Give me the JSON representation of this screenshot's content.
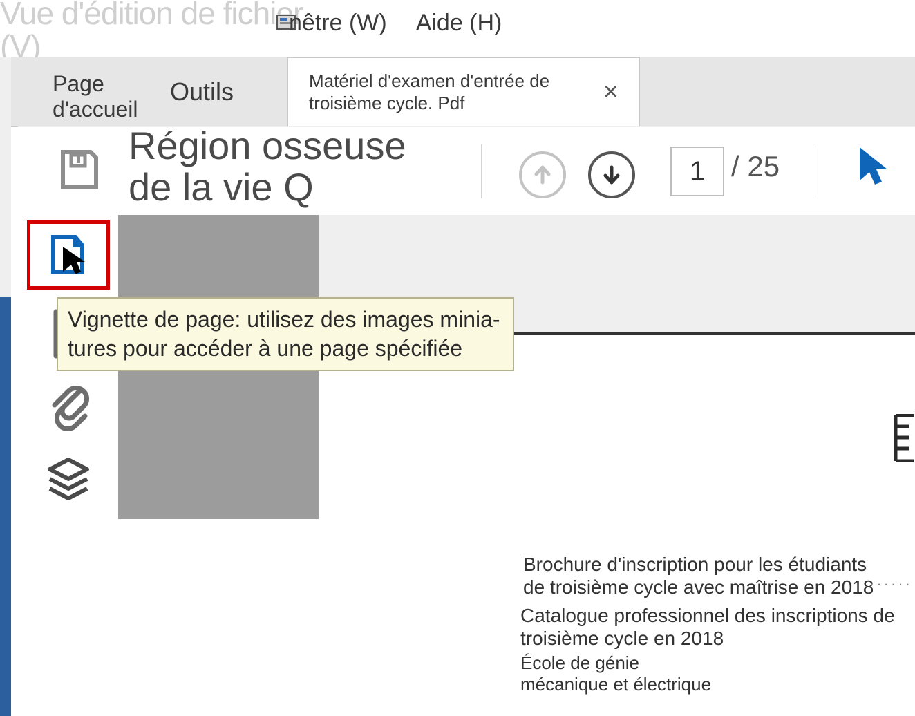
{
  "menu": {
    "edit_view_label": "Vue d'édition de fichier.\n(V)",
    "window_label": "nêtre (W)",
    "help_label": "Aide (H)"
  },
  "tabs": {
    "home": "Page\nd'accueil",
    "tools": "Outils",
    "document_title": "Matériel d'examen d'entrée de troisième cycle. Pdf",
    "close_glyph": "×"
  },
  "toolbar": {
    "doc_heading": "Région osseuse de la vie Q",
    "page_current": "1",
    "page_total": "/ 25"
  },
  "tooltip": {
    "text": "Vignette de page: utilisez des images minia-tures pour accéder à une page spécifiée"
  },
  "document": {
    "line1": "Brochure d'inscription pour les étudiants de troisième cycle avec maîtrise en 2018",
    "line2": "Catalogue professionnel des inscriptions de troisième cycle en 2018",
    "line3": "École de génie mécanique et électrique",
    "dots": "······"
  }
}
